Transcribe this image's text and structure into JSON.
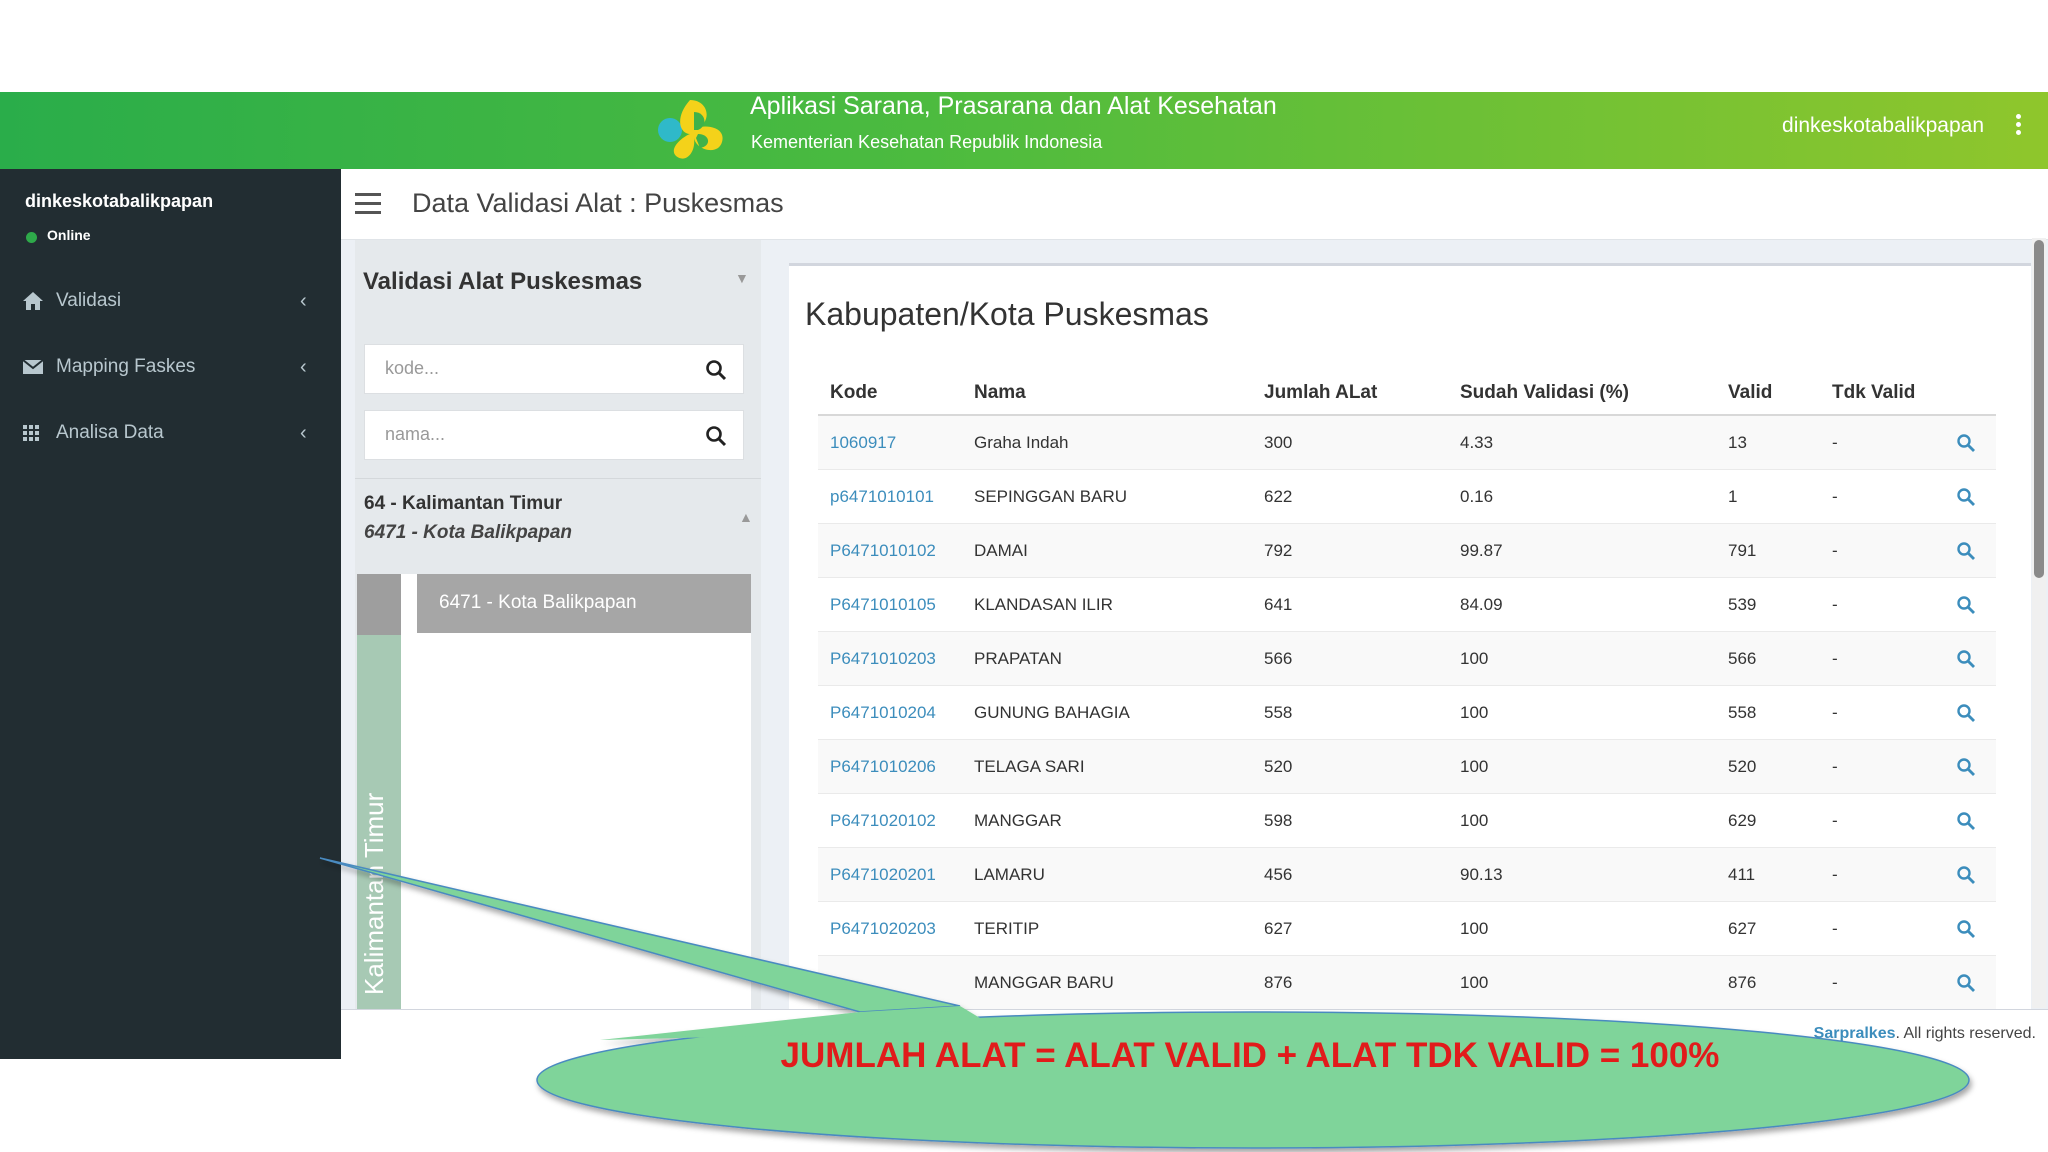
{
  "header": {
    "app_title": "Aplikasi Sarana, Prasarana dan Alat Kesehatan",
    "app_subtitle": "Kementerian Kesehatan Republik Indonesia",
    "user": "dinkeskotabalikpapan",
    "colors": {
      "start": "#2aad4a",
      "end": "#8fc62c"
    }
  },
  "sidebar": {
    "username": "dinkeskotabalikpapan",
    "status": "Online",
    "menu": [
      {
        "label": "Validasi",
        "icon": "home-icon"
      },
      {
        "label": "Mapping Faskes",
        "icon": "envelope-icon"
      },
      {
        "label": "Analisa Data",
        "icon": "grid-icon"
      }
    ]
  },
  "page": {
    "title": "Data Validasi Alat : Puskesmas"
  },
  "filter": {
    "title": "Validasi Alat Puskesmas",
    "kode_placeholder": "kode...",
    "nama_placeholder": "nama...",
    "province": "64 - Kalimantan Timur",
    "city": "6471 - Kota Balikpapan",
    "tree_selected": "6471 - Kota Balikpapan",
    "tree_side_label": "Kalimantan Timur"
  },
  "table": {
    "title": "Kabupaten/Kota Puskesmas",
    "columns": [
      "Kode",
      "Nama",
      "Jumlah ALat",
      "Sudah Validasi (%)",
      "Valid",
      "Tdk Valid"
    ],
    "rows": [
      {
        "kode": "1060917",
        "nama": "Graha Indah",
        "jumlah": "300",
        "sudah": "4.33",
        "valid": "13",
        "tdk": "-"
      },
      {
        "kode": "p6471010101",
        "nama": "SEPINGGAN BARU",
        "jumlah": "622",
        "sudah": "0.16",
        "valid": "1",
        "tdk": "-"
      },
      {
        "kode": "P6471010102",
        "nama": "DAMAI",
        "jumlah": "792",
        "sudah": "99.87",
        "valid": "791",
        "tdk": "-"
      },
      {
        "kode": "P6471010105",
        "nama": "KLANDASAN ILIR",
        "jumlah": "641",
        "sudah": "84.09",
        "valid": "539",
        "tdk": "-"
      },
      {
        "kode": "P6471010203",
        "nama": "PRAPATAN",
        "jumlah": "566",
        "sudah": "100",
        "valid": "566",
        "tdk": "-"
      },
      {
        "kode": "P6471010204",
        "nama": "GUNUNG BAHAGIA",
        "jumlah": "558",
        "sudah": "100",
        "valid": "558",
        "tdk": "-"
      },
      {
        "kode": "P6471010206",
        "nama": "TELAGA SARI",
        "jumlah": "520",
        "sudah": "100",
        "valid": "520",
        "tdk": "-"
      },
      {
        "kode": "P6471020102",
        "nama": "MANGGAR",
        "jumlah": "598",
        "sudah": "100",
        "valid": "629",
        "tdk": "-"
      },
      {
        "kode": "P6471020201",
        "nama": "LAMARU",
        "jumlah": "456",
        "sudah": "90.13",
        "valid": "411",
        "tdk": "-"
      },
      {
        "kode": "P6471020203",
        "nama": "TERITIP",
        "jumlah": "627",
        "sudah": "100",
        "valid": "627",
        "tdk": "-"
      },
      {
        "kode": "",
        "nama": "MANGGAR BARU",
        "jumlah": "876",
        "sudah": "100",
        "valid": "876",
        "tdk": "-"
      }
    ]
  },
  "footer": {
    "link": "Sarpralkes",
    "suffix": ". All rights reserved."
  },
  "callout": {
    "text": "JUMLAH ALAT = ALAT VALID + ALAT TDK VALID = 100%",
    "text_color": "#e11b1b",
    "fill_color": "#7fd49a"
  }
}
